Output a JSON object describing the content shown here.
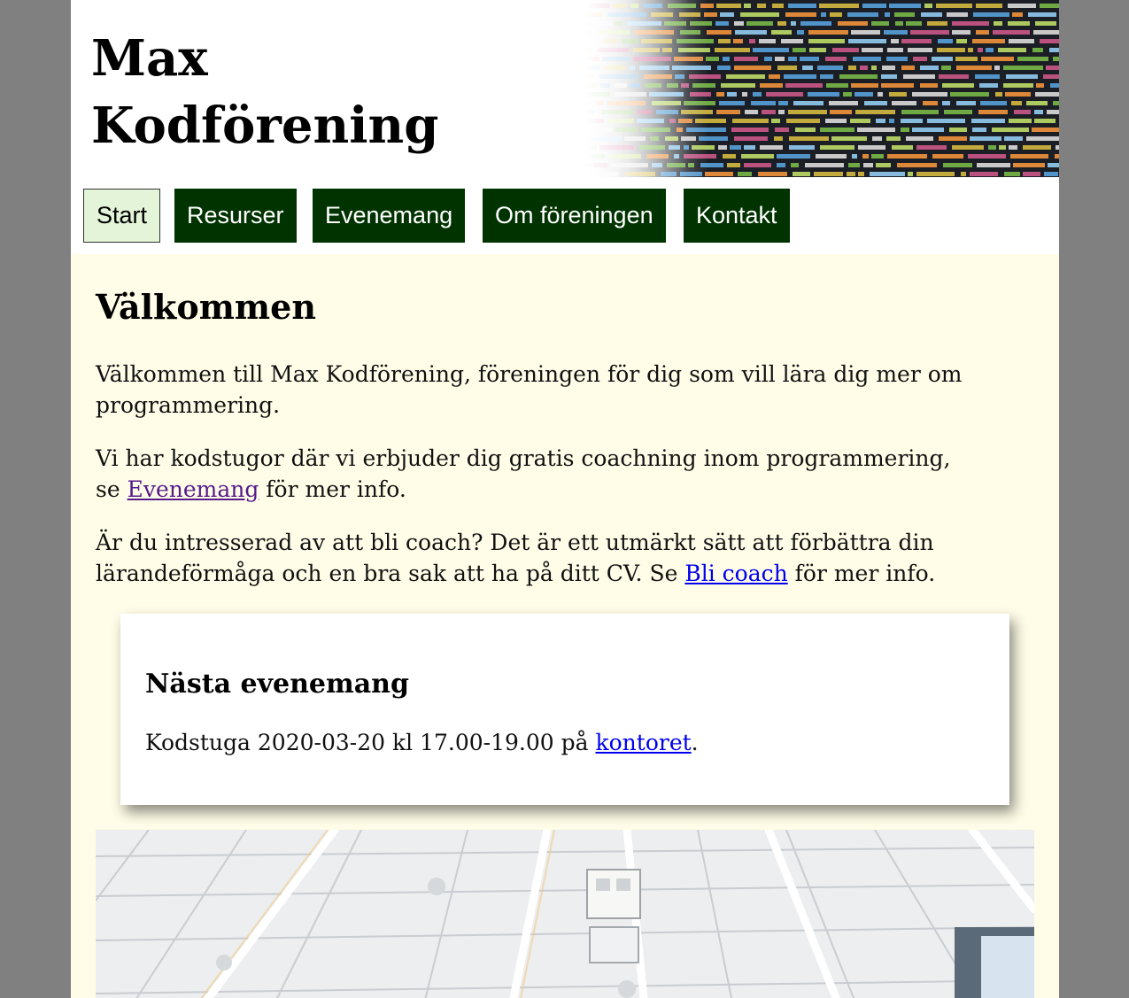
{
  "header": {
    "site_title_line1": "Max",
    "site_title_line2": "Kodförening"
  },
  "nav": {
    "items": [
      {
        "label": "Start",
        "active": true
      },
      {
        "label": "Resurser",
        "active": false
      },
      {
        "label": "Evenemang",
        "active": false
      },
      {
        "label": "Om föreningen",
        "active": false
      },
      {
        "label": "Kontakt",
        "active": false
      }
    ]
  },
  "main": {
    "heading": "Välkommen",
    "p1": "Välkommen till Max Kodförening, föreningen för dig som vill lära dig mer om programmering.",
    "p2_before": "Vi har kodstugor där vi erbjuder dig gratis coachning inom programmering, se ",
    "p2_link": "Evenemang",
    "p2_after": " för mer info.",
    "p3_before": "Är du intresserad av att bli coach? Det är ett utmärkt sätt att förbättra din lärandeförmåga och en bra sak att ha på ditt CV. Se ",
    "p3_link": "Bli coach",
    "p3_after": " för mer info."
  },
  "event": {
    "heading": "Nästa evenemang",
    "text_before": "Kodstuga 2020-03-20 kl 17.00-19.00 på ",
    "link": "kontoret",
    "text_after": "."
  },
  "colors": {
    "nav_bg": "#003300",
    "nav_active_bg": "#e3f4d8",
    "content_bg": "#fffde7",
    "outer_bg": "#808080",
    "link": "#0000ee",
    "link_visited": "#551a8b"
  }
}
